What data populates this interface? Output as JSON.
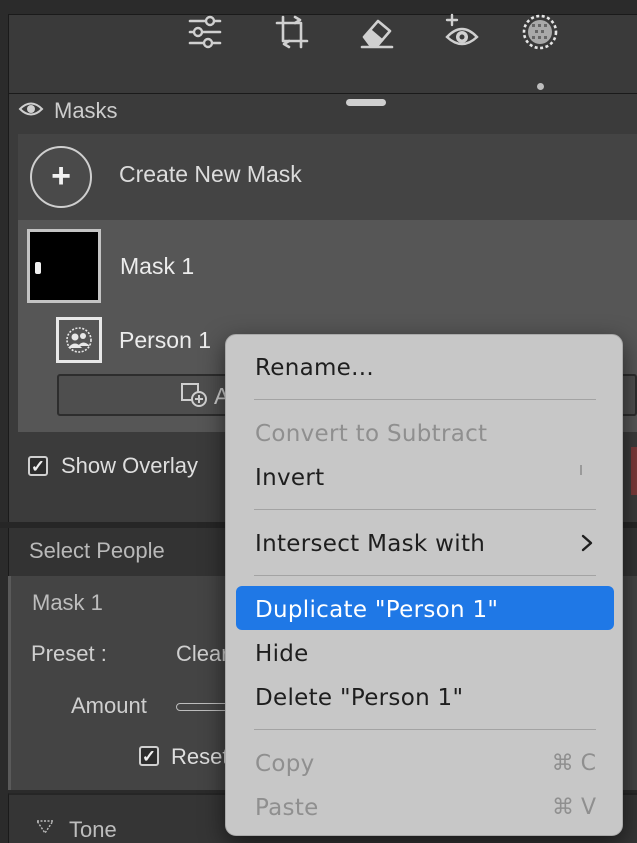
{
  "toolbar": {
    "tools": [
      {
        "icon": "sliders-icon"
      },
      {
        "icon": "crop-icon"
      },
      {
        "icon": "eraser-icon"
      },
      {
        "icon": "redeye-icon"
      },
      {
        "icon": "masking-icon"
      }
    ]
  },
  "masks_panel": {
    "title": "Masks",
    "create_label": "Create New Mask",
    "create_symbol": "+",
    "mask": {
      "name": "Mask 1"
    },
    "component": {
      "name": "Person 1"
    },
    "add_button_label": "A",
    "show_overlay": {
      "label": "Show Overlay",
      "checked": true,
      "check_glyph": "✓"
    }
  },
  "select_people": {
    "label": "Select People"
  },
  "mask_settings": {
    "title": "Mask 1",
    "preset_label": "Preset :",
    "preset_value": "Clear",
    "amount_label": "Amount",
    "reset_label": "Reset",
    "reset_checked": true,
    "check_glyph": "✓"
  },
  "tone": {
    "label": "Tone"
  },
  "context_menu": {
    "items": {
      "rename": "Rename...",
      "convert": "Convert to Subtract",
      "invert": "Invert",
      "intersect": "Intersect Mask with",
      "duplicate": "Duplicate \"Person 1\"",
      "hide": "Hide",
      "delete": "Delete \"Person 1\"",
      "copy": "Copy",
      "paste": "Paste"
    },
    "shortcuts": {
      "copy": "⌘ C",
      "paste": "⌘ V"
    },
    "highlighted": "duplicate",
    "highlight_color": "#1f78e6"
  }
}
